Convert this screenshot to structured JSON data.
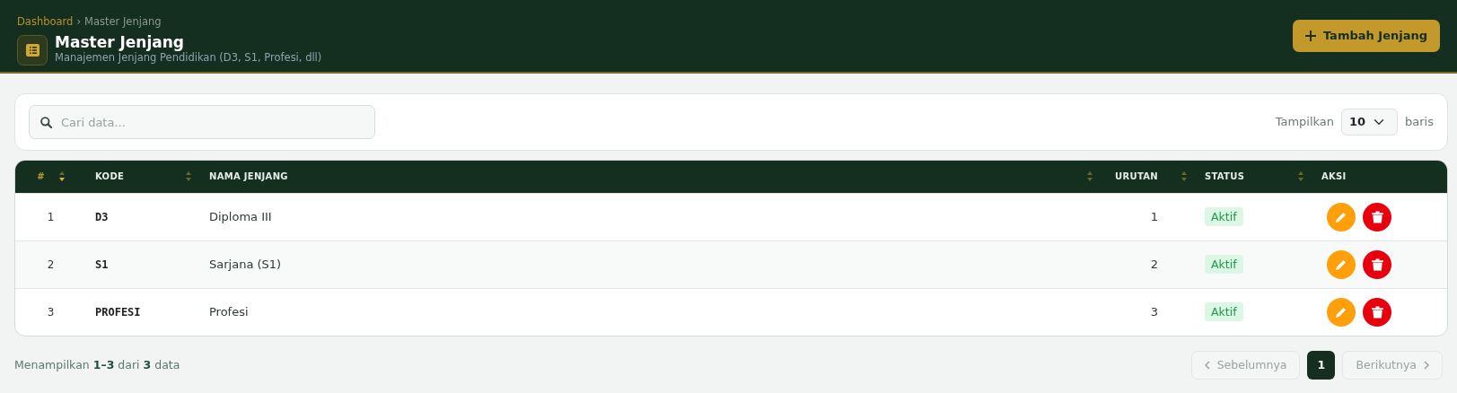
{
  "breadcrumb": [
    {
      "label": "Dashboard",
      "link": true
    },
    {
      "label": "Master Jenjang",
      "link": false
    }
  ],
  "breadcrumb_separator": "›",
  "page": {
    "title": "Master Jenjang",
    "subtitle": "Manajemen Jenjang Pendidikan (D3, S1, Profesi, dll)"
  },
  "add_button": {
    "label": "Tambah Jenjang"
  },
  "search": {
    "placeholder": "Cari data..."
  },
  "page_size": {
    "label": "Tampilkan",
    "value": "10",
    "suffix": "baris"
  },
  "table": {
    "columns": [
      {
        "label": "#",
        "sortable": true,
        "sorted": true
      },
      {
        "label": "KODE",
        "sortable": true,
        "sorted": false
      },
      {
        "label": "NAMA JENJANG",
        "sortable": true,
        "sorted": false
      },
      {
        "label": "URUTAN",
        "sortable": true,
        "sorted": false
      },
      {
        "label": "STATUS",
        "sortable": true,
        "sorted": false
      },
      {
        "label": "AKSI",
        "sortable": false,
        "sorted": false
      }
    ],
    "rows": [
      {
        "no": "1",
        "kode": "D3",
        "nama": "Diploma III",
        "urutan": "1",
        "status": "Aktif",
        "active": true
      },
      {
        "no": "2",
        "kode": "S1",
        "nama": "Sarjana (S1)",
        "urutan": "2",
        "status": "Aktif",
        "active": true
      },
      {
        "no": "3",
        "kode": "PROFESI",
        "nama": "Profesi",
        "urutan": "3",
        "status": "Aktif",
        "active": true
      }
    ]
  },
  "summary": "Menampilkan **1–3** dari **3** data",
  "pagination": {
    "prev": {
      "label": "Sebelumnya",
      "disabled": true
    },
    "pages": [
      {
        "label": "1",
        "selected": true
      }
    ],
    "next": {
      "label": "Berikutnya",
      "disabled": true
    }
  }
}
